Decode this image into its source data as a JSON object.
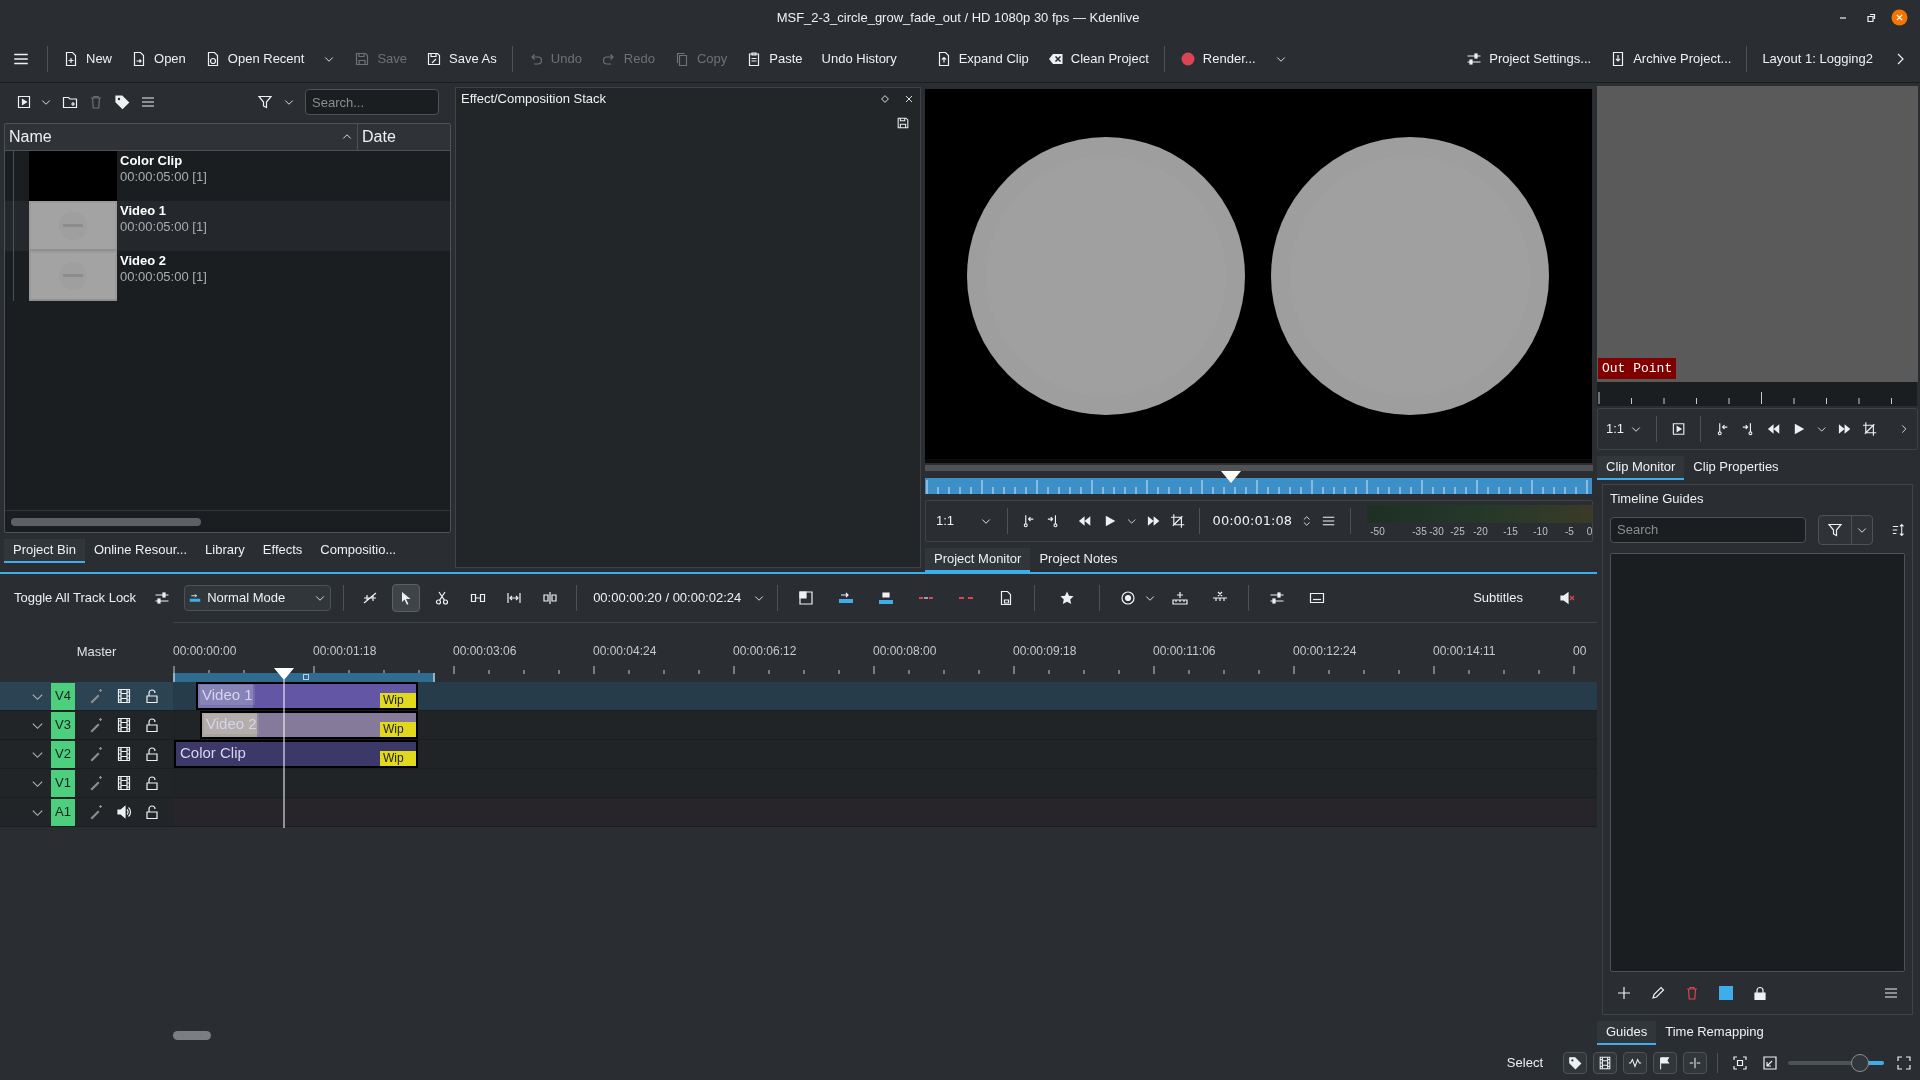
{
  "window": {
    "title": "MSF_2-3_circle_grow_fade_out / HD 1080p 30 fps — Kdenlive"
  },
  "toolbar": [
    {
      "label": "New",
      "disabled": false
    },
    {
      "label": "Open",
      "disabled": false
    },
    {
      "label": "Open Recent",
      "disabled": false
    },
    {
      "label": "Save",
      "disabled": true
    },
    {
      "label": "Save As",
      "disabled": false
    },
    {
      "label": "Undo",
      "disabled": true
    },
    {
      "label": "Redo",
      "disabled": true
    },
    {
      "label": "Copy",
      "disabled": true
    },
    {
      "label": "Paste",
      "disabled": false
    },
    {
      "label": "Undo History",
      "disabled": false
    },
    {
      "label": "Expand Clip",
      "disabled": false
    },
    {
      "label": "Clean Project",
      "disabled": false
    },
    {
      "label": "Render...",
      "disabled": false
    },
    {
      "label": "Project Settings...",
      "disabled": false
    },
    {
      "label": "Archive Project...",
      "disabled": false
    },
    {
      "label": "Layout 1: Logging2",
      "disabled": false
    }
  ],
  "project_bin": {
    "search": {
      "placeholder": "Search..."
    },
    "columns": [
      "Name",
      "Date"
    ],
    "clips": [
      {
        "name": "Color Clip",
        "duration": "00:00:05:00 [1]",
        "kind": "color"
      },
      {
        "name": "Video 1",
        "duration": "00:00:05:00 [1]",
        "kind": "video"
      },
      {
        "name": "Video 2",
        "duration": "00:00:05:00 [1]",
        "kind": "video"
      }
    ]
  },
  "left_tabs": [
    {
      "label": "Project Bin",
      "selected": true
    },
    {
      "label": "Online Resour...",
      "selected": false
    },
    {
      "label": "Library",
      "selected": false
    },
    {
      "label": "Effects",
      "selected": false
    },
    {
      "label": "Compositio...",
      "selected": false
    }
  ],
  "effect_stack": {
    "title": "Effect/Composition Stack"
  },
  "project_monitor": {
    "zoom": "1:1",
    "timecode": "00:00:01:08",
    "meter_labels": [
      "-50",
      "-35",
      "-30",
      "-25",
      "-20",
      "-15",
      "-10",
      "-5",
      "0"
    ],
    "tabs": [
      {
        "label": "Project Monitor",
        "selected": true
      },
      {
        "label": "Project Notes",
        "selected": false
      }
    ]
  },
  "clip_monitor": {
    "marker": "Out Point",
    "zoom": "1:1",
    "tabs": [
      {
        "label": "Clip Monitor",
        "selected": true
      },
      {
        "label": "Clip Properties",
        "selected": false
      }
    ]
  },
  "guides": {
    "title": "Timeline Guides",
    "search": {
      "placeholder": "Search"
    },
    "tabs": [
      {
        "label": "Guides",
        "selected": true
      },
      {
        "label": "Time Remapping",
        "selected": false
      }
    ]
  },
  "timeline_toolbar": {
    "lock_label": "Toggle All Track Lock",
    "mode": "Normal Mode",
    "tools": [
      {
        "selected": false
      },
      {
        "selected": true
      },
      {
        "selected": false
      },
      {
        "selected": false
      },
      {
        "selected": false
      },
      {
        "selected": false
      }
    ],
    "timecode": "00:00:00:20 / 00:00:02:24",
    "subtitles": "Subtitles"
  },
  "timeline": {
    "master": "Master",
    "ruler": [
      "00:00:00:00",
      "00:00:01:18",
      "00:00:03:06",
      "00:00:04:24",
      "00:00:06:12",
      "00:00:08:00",
      "00:00:09:18",
      "00:00:11:06",
      "00:00:12:24",
      "00:00:14:11",
      "00"
    ],
    "tracks": [
      {
        "name": "V4",
        "kind": "video",
        "selected": true,
        "clips": [
          {
            "name": "Video 1",
            "composition": "Wip"
          }
        ]
      },
      {
        "name": "V3",
        "kind": "video",
        "selected": false,
        "clips": [
          {
            "name": "Video 2",
            "composition": "Wip"
          }
        ]
      },
      {
        "name": "V2",
        "kind": "video",
        "selected": false,
        "clips": [
          {
            "name": "Color Clip",
            "composition": "Wip"
          }
        ]
      },
      {
        "name": "V1",
        "kind": "video",
        "selected": false
      },
      {
        "name": "A1",
        "kind": "audio",
        "selected": false
      }
    ]
  },
  "status_bar": {
    "mode": "Select",
    "zoom_slider": {
      "level": 0.75
    }
  }
}
